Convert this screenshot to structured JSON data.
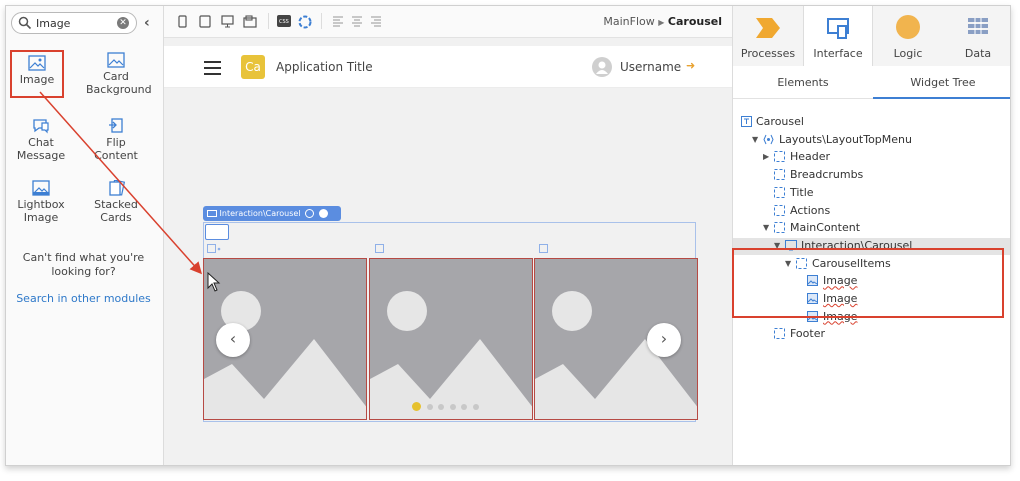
{
  "left_panel": {
    "search": {
      "value": "Image"
    },
    "widgets": [
      {
        "label": "Image",
        "icon": "image-icon"
      },
      {
        "label": "Card Background",
        "icon": "card-background-icon"
      },
      {
        "label": "Chat Message",
        "icon": "chat-message-icon"
      },
      {
        "label": "Flip Content",
        "icon": "flip-content-icon"
      },
      {
        "label": "Lightbox Image",
        "icon": "lightbox-image-icon"
      },
      {
        "label": "Stacked Cards",
        "icon": "stacked-cards-icon"
      }
    ],
    "help_text": "Can't find what you're looking for?",
    "help_link": "Search in other modules"
  },
  "toolbar": {
    "breadcrumb_parent": "MainFlow",
    "breadcrumb_current": "Carousel"
  },
  "canvas": {
    "app_logo": "Ca",
    "app_title": "Application Title",
    "username": "Username",
    "carousel_tag": "Interaction\\Carousel",
    "prev_label": "‹",
    "next_label": "›",
    "dots_count": 6,
    "active_dot": 1
  },
  "right_panel": {
    "main_tabs": [
      "Processes",
      "Interface",
      "Logic",
      "Data"
    ],
    "active_main_tab": "Interface",
    "sub_tabs": [
      "Elements",
      "Widget Tree"
    ],
    "active_sub_tab": "Widget Tree",
    "tree": [
      {
        "label": "Carousel",
        "depth": 0,
        "arrow": "",
        "icon": "screen-icon"
      },
      {
        "label": "Layouts\\LayoutTopMenu",
        "depth": 1,
        "arrow": "▼",
        "icon": "block-icon"
      },
      {
        "label": "Header",
        "depth": 2,
        "arrow": "▶",
        "icon": "placeholder-icon"
      },
      {
        "label": "Breadcrumbs",
        "depth": 2,
        "arrow": "",
        "icon": "placeholder-icon"
      },
      {
        "label": "Title",
        "depth": 2,
        "arrow": "",
        "icon": "placeholder-icon"
      },
      {
        "label": "Actions",
        "depth": 2,
        "arrow": "",
        "icon": "placeholder-icon"
      },
      {
        "label": "MainContent",
        "depth": 2,
        "arrow": "▼",
        "icon": "placeholder-icon"
      },
      {
        "label": "Interaction\\Carousel",
        "depth": 3,
        "arrow": "▼",
        "icon": "monitor-icon"
      },
      {
        "label": "CarouselItems",
        "depth": 4,
        "arrow": "▼",
        "icon": "placeholder-icon"
      },
      {
        "label": "Image",
        "depth": 5,
        "arrow": "",
        "icon": "image-icon"
      },
      {
        "label": "Image",
        "depth": 5,
        "arrow": "",
        "icon": "image-icon"
      },
      {
        "label": "Image",
        "depth": 5,
        "arrow": "",
        "icon": "image-icon"
      },
      {
        "label": "Footer",
        "depth": 2,
        "arrow": "",
        "icon": "placeholder-icon"
      }
    ]
  },
  "colors": {
    "accent_blue": "#3d7fd3",
    "highlight_red": "#d9412e",
    "logo_yellow": "#e8c33a",
    "tab_orange": "#f0a830"
  }
}
